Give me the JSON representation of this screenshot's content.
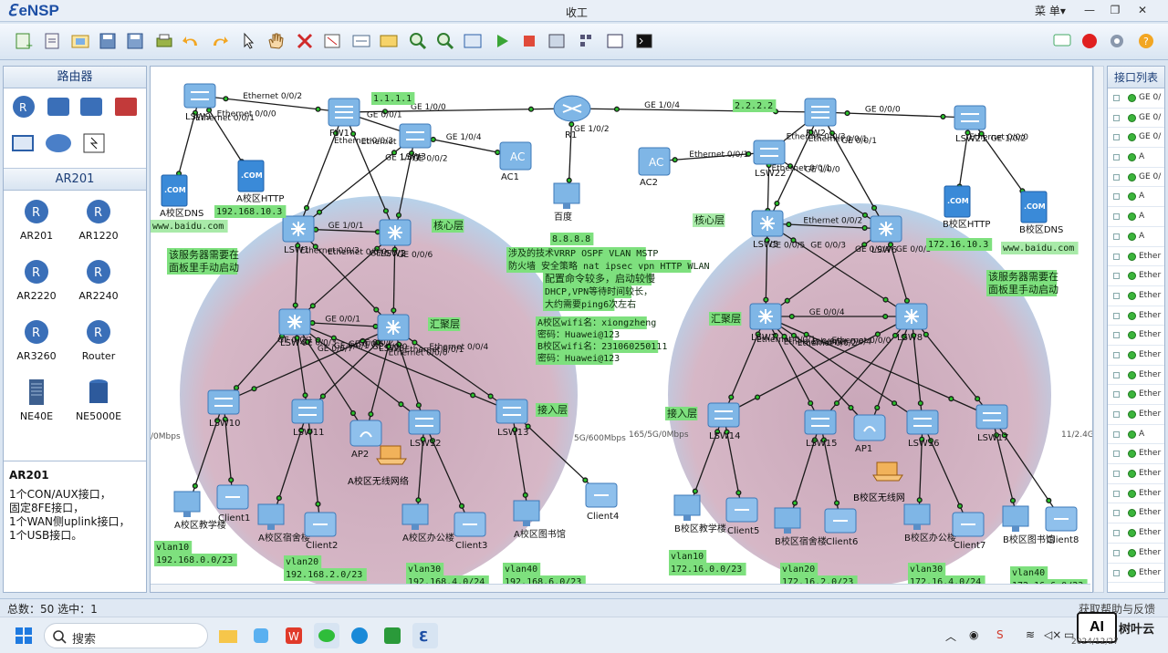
{
  "app": {
    "name": "eNSP",
    "window_title": "收工",
    "menu_label": "菜 单▾"
  },
  "left_panel": {
    "header_top": "路由器",
    "header_bottom": "AR201",
    "devices": [
      "AR201",
      "AR1220",
      "AR2220",
      "AR2240",
      "AR3260",
      "Router",
      "NE40E",
      "NE5000E"
    ],
    "desc_title": "AR201",
    "desc_lines": [
      "1个CON/AUX接口，",
      "固定8FE接口，",
      "1个WAN侧uplink接口，",
      "1个USB接口。"
    ]
  },
  "right_panel": {
    "header": "接口列表",
    "rows": [
      "GE 0/",
      "GE 0/",
      "GE 0/",
      "A",
      "GE 0/",
      "A",
      "A",
      "A",
      "Ether",
      "Ether",
      "Ether",
      "Ether",
      "Ether",
      "Ether",
      "Ether",
      "Ether",
      "Ether",
      "A",
      "Ether",
      "Ether",
      "Ether",
      "Ether",
      "Ether",
      "Ether",
      "Ether"
    ]
  },
  "status": {
    "left": "总数：50  选中：1",
    "right": "获取帮助与反馈"
  },
  "taskbar": {
    "search": "搜索",
    "brand": "树叶云",
    "date": "2024/12/27",
    "ai": "AI"
  },
  "topology": {
    "zone_labels": {
      "core_a": "核心层",
      "agg_a": "汇聚层",
      "acc_a": "接入层",
      "core_b": "核心层",
      "agg_b": "汇聚层",
      "acc_b": "接入层"
    },
    "ip_labels": {
      "isp_a": "1.1.1.1",
      "isp_b": "2.2.2.2",
      "baidu_ip": "8.8.8.8",
      "http_a": "192.168.10.3",
      "http_b": "172.16.10.3",
      "dns_a": "www.baidu.com",
      "dns_b": "www.baidu.com"
    },
    "notes": {
      "server_a_1": "该服务器需要在",
      "server_a_2": "面板里手动启动",
      "server_b_1": "该服务器需要在",
      "server_b_2": "面板里手动启动",
      "tech_1": "涉及的技术VRRP OSPF VLAN MSTP",
      "tech_2": "防火墙 安全策略 nat ipsec vpn HTTP WLAN",
      "cfg_1": "配置命令较多，启动较慢",
      "cfg_2": "DHCP,VPN等待时间较长，",
      "cfg_3": "大约需要ping6次左右",
      "wifi_1": "A校区wifi名：xiongzheng",
      "wifi_2": "密码：Huawei@123",
      "wifi_3": "B校区wifi名：231060250111",
      "wifi_4": "密码：Huawei@123"
    },
    "vlans": [
      {
        "v": "vlan10",
        "ip": "192.168.0.0/23"
      },
      {
        "v": "vlan20",
        "ip": "192.168.2.0/23"
      },
      {
        "v": "vlan30",
        "ip": "192.168.4.0/24"
      },
      {
        "v": "vlan40",
        "ip": "192.168.6.0/23"
      },
      {
        "v": "vlan10",
        "ip": "172.16.0.0/23"
      },
      {
        "v": "vlan20",
        "ip": "172.16.2.0/23"
      },
      {
        "v": "vlan30",
        "ip": "172.16.4.0/24"
      },
      {
        "v": "vlan40",
        "ip": "172.16.6.0/23"
      }
    ],
    "nodes": {
      "lsw9": "LSW9",
      "fw1": "FW1",
      "lsw3": "LSW3",
      "ac1": "AC1",
      "r1": "R1",
      "baidu": "百度",
      "ac2": "AC2",
      "lsw22": "LSW22",
      "fw2": "FW2",
      "lsw21": "LSW21",
      "dns_a_label": "A校区DNS",
      "http_a_label": "A校区HTTP",
      "http_b_label": "B校区HTTP",
      "dns_b_label": "B校区DNS",
      "lsw1": "LSW1",
      "lsw2": "LSW2",
      "lsw5": "LSW5",
      "lsw6": "LSW6",
      "lsw4": "LSW4",
      "lsw8a": "LSW8",
      "lsw7": "LSW7",
      "lsw8b": "LSW8",
      "lsw10": "LSW10",
      "lsw11": "LSW11",
      "ap2": "AP2",
      "lsw12": "LSW12",
      "lsw13": "LSW13",
      "lsw14": "LSW14",
      "lsw15": "LSW15",
      "ap1": "AP1",
      "lsw16": "LSW16",
      "lsw17": "LSW17",
      "pc_a1": "A校区教学楼",
      "c1": "Client1",
      "pc_a2": "A校区宿舍楼",
      "c2": "Client2",
      "wifi_a": "A校区无线网络",
      "pc_a3": "A校区办公楼",
      "c3": "Client3",
      "pc_a4": "A校区图书馆",
      "c4": "Client4",
      "pc_b1": "B校区教学楼",
      "c5": "Client5",
      "pc_b2": "B校区宿舍楼",
      "c6": "Client6",
      "wifi_b": "B校区无线网",
      "pc_b3": "B校区办公楼",
      "c7": "Client7",
      "pc_b4": "B校区图书馆",
      "c8": "Client8"
    },
    "port_labels": {
      "p1": "Ethernet 0/0/2",
      "p2": "GE 1/0/0",
      "p3": "GE 1/0/4",
      "p4": "GE 0/0/0",
      "p5": "GE 0/0/1",
      "p6": "GE 1/0/4",
      "p7": "GE 1/0/2",
      "p8": "Ethernet 0/0/1",
      "p9": "Ethernet 0/0/3",
      "p10": "Ethernet 0/0/1",
      "p11": "Ethernet 0/0/0",
      "p12": "Ethernet 0/0/0",
      "p13": "GE 1/0/2",
      "p14": "Ethernet 0/0/3",
      "p15": "Ethernet 0/0/2",
      "p16": "GE 1/0/1",
      "p17": "GE 0/0/2",
      "p18": "Ethernet 0/0/1",
      "p19": "GE 0/0/1",
      "p20": "Ethernet 0/0/1",
      "p21": "GE 1/0/0",
      "p22": "GE 1/0/1",
      "p23": "Ethernet 0/0/2",
      "p24": "Ethernet 0/0/3",
      "p25": "Ethernet 0/0/0",
      "p26": "GE 0/0/1",
      "p27": "GE 0/0/6",
      "p28": "GE 0/0/1",
      "p29": "GE 0/0/5",
      "p30": "GE 0/0/3",
      "p31": "GE 0/0/4",
      "p32": "GE 0/0/5",
      "p33": "GE 0/0/4",
      "p34": "GE 0/0/1",
      "p35": "GE 0/0/3",
      "p36": "GE 0/0/1",
      "p37": "GE 0/0/2",
      "p38": "GE 0/0/7",
      "p39": "GE 0/0/6",
      "p40": "GE 0/0/0",
      "p41": "Ethernet 0/0/1",
      "p42": "Ethernet 0/0/4",
      "p43": "Ethernet 0/0/0",
      "p44": "Ethernet 0/0/1",
      "p45": "Ethernet 0/0/3",
      "p46": "Ethernet 0/0/4",
      "p47": "Ethernet 0/0/0",
      "p48": "Ethernet 0/0/2",
      "bw_a": "/0Mbps",
      "bw_mid": "5G/600Mbps",
      "bw_mid2": "165/5G/0Mbps",
      "bw_b": "11/2.4G"
    }
  }
}
